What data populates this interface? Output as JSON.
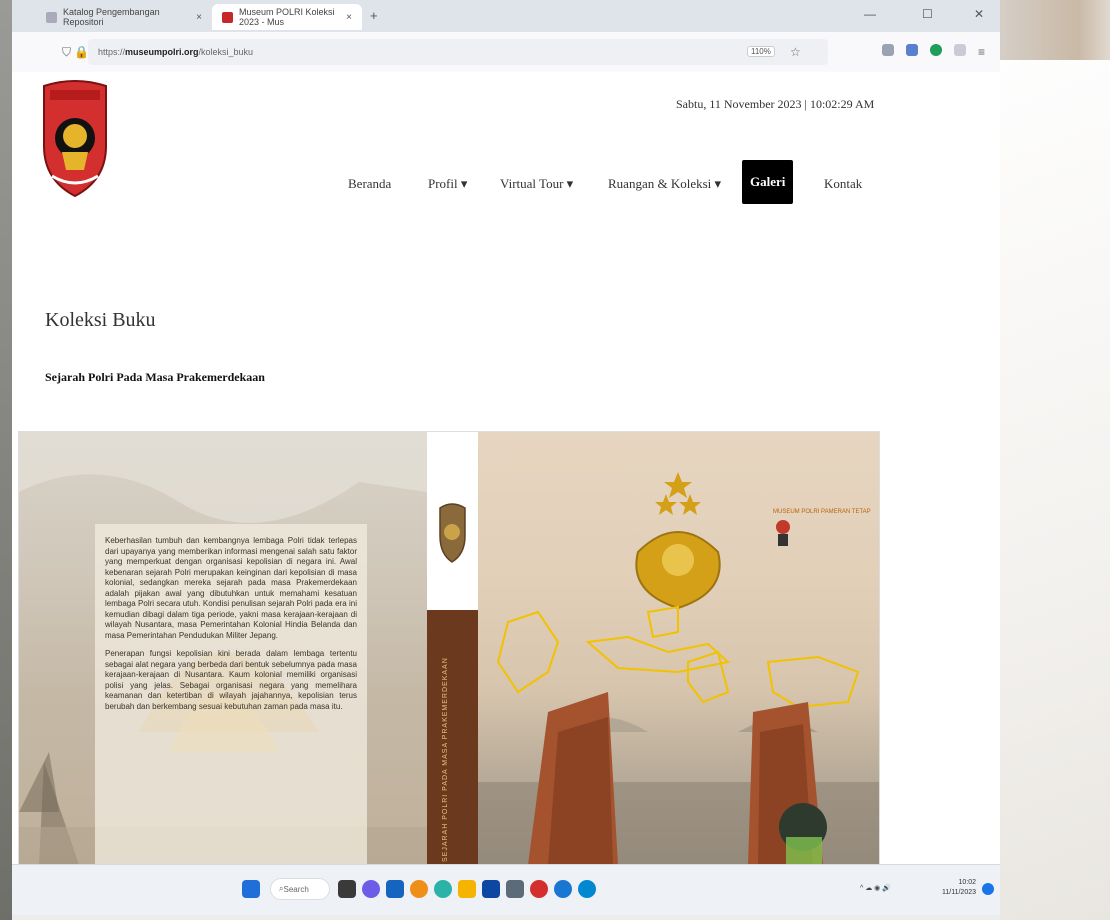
{
  "browser": {
    "tabs": [
      {
        "label": "Katalog Pengembangan Repositori"
      },
      {
        "label": "Museum POLRI Koleksi 2023 - Mus"
      }
    ],
    "new_tab_label": "+",
    "url_prefix": "https://",
    "url_domain": "museumpolri.org",
    "url_path": "/koleksi_buku",
    "zoom": "110%",
    "window_controls": [
      "—",
      "☐",
      "✕"
    ]
  },
  "site": {
    "datetime": "Sabtu, 11 November 2023 | 10:02:29 AM",
    "menu": [
      {
        "label": "Beranda",
        "active": false
      },
      {
        "label": "Profil ▾",
        "active": false
      },
      {
        "label": "Virtual Tour ▾",
        "active": false
      },
      {
        "label": "Ruangan & Koleksi ▾",
        "active": false
      },
      {
        "label": "Galeri",
        "active": true
      },
      {
        "label": "Kontak",
        "active": false
      }
    ],
    "page_title": "Koleksi Buku",
    "section_title": "Sejarah Polri Pada Masa Prakemerdekaan"
  },
  "book": {
    "back_text_p1": "Keberhasilan tumbuh dan kembangnya lembaga Polri tidak terlepas dari upayanya yang memberikan informasi mengenai salah satu faktor yang memperkuat dengan organisasi kepolisian di negara ini. Awal kebenaran sejarah Polri merupakan keinginan dari kepolisian di masa kolonial, sedangkan mereka sejarah pada masa Prakemerdekaan adalah pijakan awal yang dibutuhkan untuk memahami kesatuan lembaga Polri secara utuh. Kondisi penulisan sejarah Polri pada era ini kemudian dibagi dalam tiga periode, yakni masa kerajaan-kerajaan di wilayah Nusantara, masa Pemerintahan Kolonial Hindia Belanda dan masa Pemerintahan Pendudukan Militer Jepang.",
    "back_text_p2": "Penerapan fungsi kepolisian kini berada dalam lembaga tertentu sebagai alat negara yang berbeda dari bentuk sebelumnya pada masa kerajaan-kerajaan di Nusantara. Kaum kolonial memiliki organisasi polisi yang jelas. Sebagai organisasi negara yang memelihara keamanan dan ketertiban di wilayah jajahannya, kepolisian terus berubah dan berkembang sesuai kebutuhan zaman pada masa itu.",
    "spine_title": "SEJARAH POLRI PADA MASA PRAKEMERDEKAAN",
    "badge_text": "MUSEUM POLRI PAMERAN TETAP"
  },
  "taskbar": {
    "search_label": "Search",
    "tray_text": "^ ☁ ◉ 🔊",
    "clock_time": "10:02",
    "clock_date": "11/11/2023"
  },
  "colors": {
    "menu_active_bg": "#000000",
    "spine_brown": "#6b3a1e",
    "emblem_red": "#d32f2f",
    "gold": "#d4a017",
    "map_outline": "#f2c200"
  }
}
